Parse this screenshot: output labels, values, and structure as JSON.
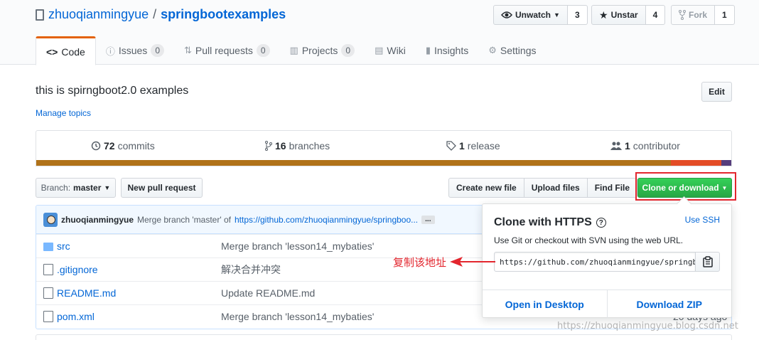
{
  "repo": {
    "owner": "zhuoqianmingyue",
    "separator": "/",
    "name": "springbootexamples"
  },
  "actions": {
    "watch": {
      "label": "Unwatch",
      "count": "3"
    },
    "star": {
      "label": "Unstar",
      "count": "4"
    },
    "fork": {
      "label": "Fork",
      "count": "1"
    }
  },
  "tabs": [
    {
      "label": "Code",
      "icon": "code-icon"
    },
    {
      "label": "Issues",
      "counter": "0",
      "icon": "issue-icon"
    },
    {
      "label": "Pull requests",
      "counter": "0",
      "icon": "pull-request-icon"
    },
    {
      "label": "Projects",
      "counter": "0",
      "icon": "project-icon"
    },
    {
      "label": "Wiki",
      "icon": "book-icon"
    },
    {
      "label": "Insights",
      "icon": "graph-icon"
    },
    {
      "label": "Settings",
      "icon": "gear-icon"
    }
  ],
  "description": "this is spirngboot2.0 examples",
  "manage_topics": "Manage topics",
  "edit_label": "Edit",
  "summary": {
    "commits": {
      "count": "72",
      "label": "commits"
    },
    "branches": {
      "count": "16",
      "label": "branches"
    },
    "releases": {
      "count": "1",
      "label": "release"
    },
    "contributors": {
      "count": "1",
      "label": "contributor"
    }
  },
  "languages": [
    {
      "color": "#b07219",
      "percent": 91.3
    },
    {
      "color": "#e34c26",
      "percent": 7.3
    },
    {
      "color": "#563d7c",
      "percent": 1.4
    }
  ],
  "toolbar": {
    "branch_prefix": "Branch:",
    "branch_name": "master",
    "new_pr": "New pull request",
    "create_file": "Create new file",
    "upload": "Upload files",
    "find": "Find File",
    "clone": "Clone or download"
  },
  "commit": {
    "author": "zhuoqianmingyue",
    "message": "Merge branch 'master' of",
    "link": "https://github.com/zhuoqianmingyue/springboo...",
    "ellipsis": "..."
  },
  "files": [
    {
      "type": "folder",
      "name": "src",
      "message": "Merge branch 'lesson14_mybaties'",
      "age": ""
    },
    {
      "type": "file",
      "name": ".gitignore",
      "message": "解决合并冲突",
      "age": ""
    },
    {
      "type": "file",
      "name": "README.md",
      "message": "Update README.md",
      "age": ""
    },
    {
      "type": "file",
      "name": "pom.xml",
      "message": "Merge branch 'lesson14_mybaties'",
      "age": "20 days ago"
    }
  ],
  "clone_popup": {
    "title": "Clone with HTTPS",
    "use_ssh": "Use SSH",
    "subtitle": "Use Git or checkout with SVN using the web URL.",
    "url": "https://github.com/zhuoqianmingyue/springbootexamples.git",
    "open_desktop": "Open in Desktop",
    "download_zip": "Download ZIP"
  },
  "annotation": "复制该地址",
  "watermark": "https://zhuoqianmingyue.blog.csdn.net"
}
